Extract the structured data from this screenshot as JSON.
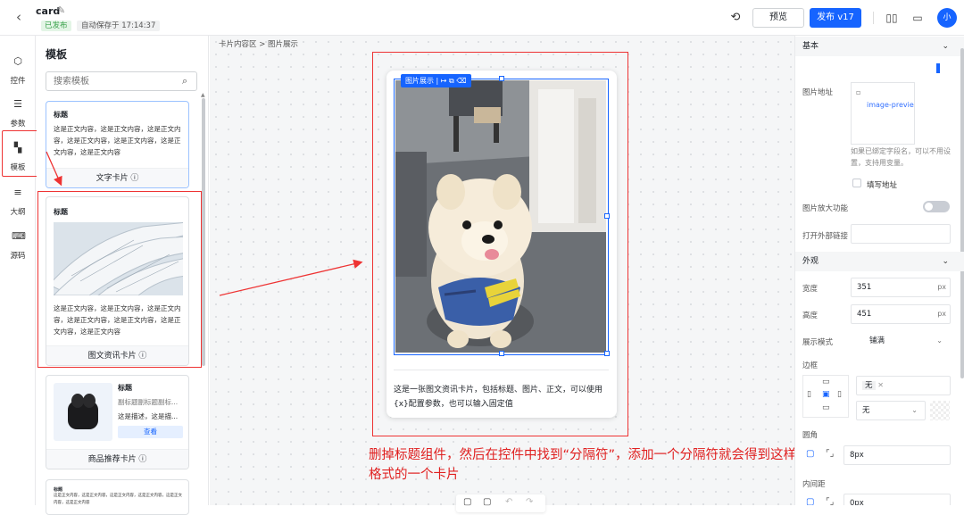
{
  "header": {
    "title": "card",
    "status": "已发布",
    "autosave": "自动保存于 17:14:37",
    "preview_label": "预览",
    "publish_label": "发布 v17",
    "avatar_text": "小",
    "accent": "#1664ff"
  },
  "rail": {
    "items": [
      {
        "label": "控件",
        "icon": "widget-icon"
      },
      {
        "label": "参数",
        "icon": "params-icon"
      },
      {
        "label": "模板",
        "icon": "template-icon"
      },
      {
        "label": "大纲",
        "icon": "outline-icon"
      },
      {
        "label": "源码",
        "icon": "code-icon"
      }
    ]
  },
  "templates": {
    "title": "模板",
    "search_placeholder": "搜索模板",
    "cards": [
      {
        "heading": "标题",
        "body": "这是正文内容，这是正文内容，这是正文内容，这是正文内容，这是正文内容，这是正文内容，这是正文内容",
        "name": "文字卡片 ⓘ"
      },
      {
        "heading": "标题",
        "body": "这是正文内容，这是正文内容，这是正文内容，这是正文内容，这是正文内容，这是正文内容，这是正文内容",
        "name": "图文资讯卡片 ⓘ"
      },
      {
        "heading": "标题",
        "subtitle": "副标题副标题副标...",
        "desc": "这是描述，这是描...",
        "button": "查看",
        "name": "商品推荐卡片 ⓘ"
      },
      {
        "heading": "标题",
        "body": "这是正文内容，这是正文内容，这是正文内容，这是正文内容，这是正文内容，这是正文内容"
      }
    ]
  },
  "canvas": {
    "breadcrumb": "卡片内容区  >  图片展示",
    "toolbar_label": "图片展示",
    "card_text": "这是一张图文资讯卡片，包括标题、图片、正文，可以使用{x}配置参数，也可以输入固定值",
    "annotation": "删掉标题组件，然后在控件中找到“分隔符”，添加一个分隔符就会得到这样格式的一个卡片"
  },
  "props": {
    "basic": {
      "title": "基本",
      "image_url_label": "图片地址",
      "image_alt": "image-previe",
      "hint": "如果已绑定字段名，可以不用设置，支持用变量。",
      "fill_address": "填写地址",
      "zoom_label": "图片放大功能",
      "link_label": "打开外部链接"
    },
    "appearance": {
      "title": "外观",
      "width_label": "宽度",
      "width_value": "351",
      "height_label": "高度",
      "height_value": "451",
      "unit": "px",
      "mode_label": "展示模式",
      "mode_value": "铺满",
      "border_label": "边框",
      "border_style": "无",
      "border_color": "无",
      "radius_label": "圆角",
      "radius_value": "8px",
      "padding_label": "内间距",
      "padding_value": "0px"
    }
  }
}
